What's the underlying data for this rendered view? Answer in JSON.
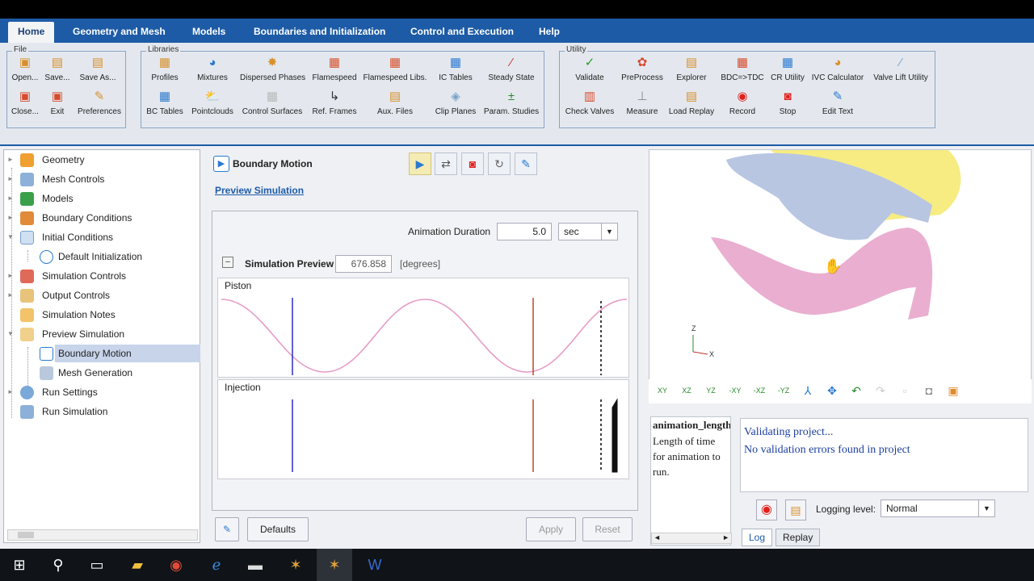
{
  "menu": {
    "tabs": [
      "Home",
      "Geometry and Mesh",
      "Models",
      "Boundaries and Initialization",
      "Control and Execution",
      "Help"
    ],
    "active": "Home"
  },
  "ribbon": {
    "file": {
      "title": "File",
      "buttons": [
        "Open...",
        "Save...",
        "Save As...",
        "Close...",
        "Exit",
        "Preferences"
      ]
    },
    "libraries": {
      "title": "Libraries",
      "buttons": [
        "Profiles",
        "Mixtures",
        "Dispersed Phases",
        "Flamespeed",
        "Flamespeed Libs.",
        "IC Tables",
        "Steady State",
        "BC Tables",
        "Pointclouds",
        "Control Surfaces",
        "Ref. Frames",
        "Aux. Files",
        "Clip Planes",
        "Param. Studies"
      ]
    },
    "utility": {
      "title": "Utility",
      "buttons": [
        "Validate",
        "PreProcess",
        "Explorer",
        "BDC=>TDC",
        "CR Utility",
        "IVC Calculator",
        "Valve Lift Utility",
        "Check Valves",
        "Measure",
        "Load Replay",
        "Record",
        "Stop",
        "Edit Text"
      ]
    }
  },
  "tree": {
    "items": [
      {
        "label": "Geometry",
        "icon": "geometry-icon",
        "level": 0
      },
      {
        "label": "Mesh Controls",
        "icon": "mesh-controls-icon",
        "level": 0
      },
      {
        "label": "Models",
        "icon": "models-icon",
        "level": 0
      },
      {
        "label": "Boundary Conditions",
        "icon": "boundary-conditions-icon",
        "level": 0
      },
      {
        "label": "Initial Conditions",
        "icon": "initial-conditions-icon",
        "level": 0
      },
      {
        "label": "Default Initialization",
        "icon": "info-icon",
        "level": 1
      },
      {
        "label": "Simulation Controls",
        "icon": "simulation-controls-icon",
        "level": 0
      },
      {
        "label": "Output Controls",
        "icon": "output-controls-icon",
        "level": 0
      },
      {
        "label": "Simulation Notes",
        "icon": "notes-icon",
        "level": 0
      },
      {
        "label": "Preview Simulation",
        "icon": "preview-icon",
        "level": 0
      },
      {
        "label": "Boundary Motion",
        "icon": "boundary-motion-icon",
        "level": 1
      },
      {
        "label": "Mesh Generation",
        "icon": "mesh-generation-icon",
        "level": 1
      },
      {
        "label": "Run Settings",
        "icon": "gear-icon",
        "level": 0
      },
      {
        "label": "Run Simulation",
        "icon": "run-icon",
        "level": 0
      }
    ],
    "selected": "Boundary Motion"
  },
  "panel": {
    "title": "Boundary Motion",
    "crumb": "Preview Simulation",
    "animation_label": "Animation Duration",
    "animation_value": "5.0",
    "animation_unit": "sec",
    "preview_label": "Simulation Preview",
    "preview_value": "676.858",
    "preview_unit": "[degrees]",
    "plot1_title": "Piston",
    "plot2_title": "Injection",
    "defaults_btn": "Defaults",
    "apply_btn": "Apply",
    "reset_btn": "Reset"
  },
  "viewport": {
    "axis_z": "Z",
    "axis_x": "X",
    "view_buttons": [
      "XY",
      "XZ",
      "YZ",
      "-XY",
      "-XZ",
      "-YZ"
    ]
  },
  "help": {
    "title": "animation_length",
    "body": "Length of time for animation to run."
  },
  "log": {
    "lines": [
      "Validating project...",
      "No validation errors found in project"
    ],
    "logging_label": "Logging level:",
    "logging_value": "Normal",
    "tabs": [
      "Log",
      "Replay"
    ]
  },
  "colors": {
    "brand": "#1d5ba6",
    "piston_curve": "#e79ac6",
    "blue_marker": "#2a2ad0",
    "red_marker": "#b5482a"
  }
}
